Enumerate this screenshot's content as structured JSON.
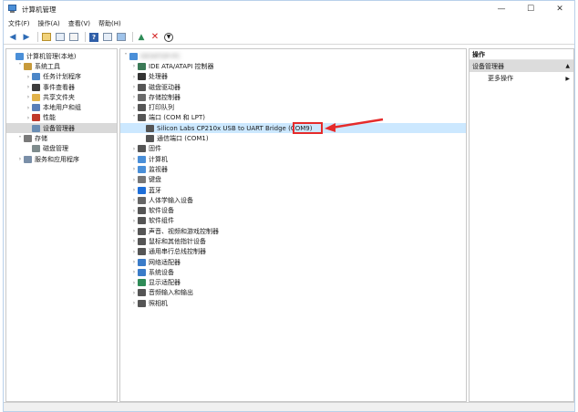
{
  "window": {
    "title": "计算机管理",
    "controls": [
      "—",
      "☐",
      "✕"
    ]
  },
  "menu": [
    "文件(F)",
    "操作(A)",
    "查看(V)",
    "帮助(H)"
  ],
  "left_tree": [
    {
      "label": "计算机管理(本地)",
      "indent": 0,
      "twisty": "",
      "icon": "computer-icon",
      "color": "#4a8fd8"
    },
    {
      "label": "系统工具",
      "indent": 1,
      "twisty": "˅",
      "icon": "tools-icon",
      "color": "#c79a3a"
    },
    {
      "label": "任务计划程序",
      "indent": 2,
      "twisty": "›",
      "icon": "clock-icon",
      "color": "#4b86c8"
    },
    {
      "label": "事件查看器",
      "indent": 2,
      "twisty": "›",
      "icon": "event-icon",
      "color": "#3c3c3c"
    },
    {
      "label": "共享文件夹",
      "indent": 2,
      "twisty": "›",
      "icon": "folder-icon",
      "color": "#e1b24a"
    },
    {
      "label": "本地用户和组",
      "indent": 2,
      "twisty": "›",
      "icon": "users-icon",
      "color": "#5a7fb8"
    },
    {
      "label": "性能",
      "indent": 2,
      "twisty": "›",
      "icon": "performance-icon",
      "color": "#c0392b"
    },
    {
      "label": "设备管理器",
      "indent": 2,
      "twisty": "",
      "icon": "device-manager-icon",
      "color": "#6a8db3",
      "selected": true
    },
    {
      "label": "存储",
      "indent": 1,
      "twisty": "˅",
      "icon": "storage-icon",
      "color": "#7a7a7a"
    },
    {
      "label": "磁盘管理",
      "indent": 2,
      "twisty": "",
      "icon": "disk-icon",
      "color": "#7f8c8d"
    },
    {
      "label": "服务和应用程序",
      "indent": 1,
      "twisty": "›",
      "icon": "services-icon",
      "color": "#7a8fa8"
    }
  ],
  "center_tree": [
    {
      "label": "DESKTOP-PC",
      "indent": 0,
      "twisty": "˅",
      "icon": "computer-icon",
      "color": "#4a8fd8",
      "blurred": true
    },
    {
      "label": "IDE ATA/ATAPI 控制器",
      "indent": 1,
      "twisty": "›",
      "icon": "ide-icon",
      "color": "#3b7a57"
    },
    {
      "label": "处理器",
      "indent": 1,
      "twisty": "›",
      "icon": "cpu-icon",
      "color": "#333333"
    },
    {
      "label": "磁盘驱动器",
      "indent": 1,
      "twisty": "›",
      "icon": "disk-icon",
      "color": "#555555"
    },
    {
      "label": "存储控制器",
      "indent": 1,
      "twisty": "›",
      "icon": "storage-controller-icon",
      "color": "#6a6a6a"
    },
    {
      "label": "打印队列",
      "indent": 1,
      "twisty": "›",
      "icon": "printer-icon",
      "color": "#555555"
    },
    {
      "label": "端口 (COM 和 LPT)",
      "indent": 1,
      "twisty": "˅",
      "icon": "port-icon",
      "color": "#555555"
    },
    {
      "label": "Silicon Labs CP210x USB to UART Bridge (COM9)",
      "indent": 2,
      "twisty": "",
      "icon": "port-icon",
      "color": "#555555",
      "highlighted": true
    },
    {
      "label": "通信端口 (COM1)",
      "indent": 2,
      "twisty": "",
      "icon": "port-icon",
      "color": "#555555"
    },
    {
      "label": "固件",
      "indent": 1,
      "twisty": "›",
      "icon": "firmware-icon",
      "color": "#555555"
    },
    {
      "label": "计算机",
      "indent": 1,
      "twisty": "›",
      "icon": "computer-icon",
      "color": "#4a8fd8"
    },
    {
      "label": "监视器",
      "indent": 1,
      "twisty": "›",
      "icon": "monitor-icon",
      "color": "#4a8fd8"
    },
    {
      "label": "键盘",
      "indent": 1,
      "twisty": "›",
      "icon": "keyboard-icon",
      "color": "#777777"
    },
    {
      "label": "蓝牙",
      "indent": 1,
      "twisty": "›",
      "icon": "bluetooth-icon",
      "color": "#1e6fd9"
    },
    {
      "label": "人体学输入设备",
      "indent": 1,
      "twisty": "›",
      "icon": "hid-icon",
      "color": "#666666"
    },
    {
      "label": "软件设备",
      "indent": 1,
      "twisty": "›",
      "icon": "software-device-icon",
      "color": "#555555"
    },
    {
      "label": "软件组件",
      "indent": 1,
      "twisty": "›",
      "icon": "software-component-icon",
      "color": "#555555"
    },
    {
      "label": "声音、视频和游戏控制器",
      "indent": 1,
      "twisty": "›",
      "icon": "audio-icon",
      "color": "#555555"
    },
    {
      "label": "鼠标和其他指针设备",
      "indent": 1,
      "twisty": "›",
      "icon": "mouse-icon",
      "color": "#555555"
    },
    {
      "label": "通用串行总线控制器",
      "indent": 1,
      "twisty": "›",
      "icon": "usb-icon",
      "color": "#555555"
    },
    {
      "label": "网络适配器",
      "indent": 1,
      "twisty": "›",
      "icon": "network-icon",
      "color": "#3a7bc8"
    },
    {
      "label": "系统设备",
      "indent": 1,
      "twisty": "›",
      "icon": "system-device-icon",
      "color": "#3a7bc8"
    },
    {
      "label": "显示适配器",
      "indent": 1,
      "twisty": "›",
      "icon": "display-adapter-icon",
      "color": "#2e8b57"
    },
    {
      "label": "音频输入和输出",
      "indent": 1,
      "twisty": "›",
      "icon": "speaker-icon",
      "color": "#555555"
    },
    {
      "label": "照相机",
      "indent": 1,
      "twisty": "›",
      "icon": "camera-icon",
      "color": "#555555"
    }
  ],
  "actions": {
    "header": "操作",
    "section": "设备管理器",
    "section_arrow": "▲",
    "more": "更多操作",
    "more_arrow": "▶"
  },
  "colors": {
    "annotation_red": "#e52b2b",
    "selection": "#d9d9d9",
    "highlight": "#cce8ff"
  }
}
